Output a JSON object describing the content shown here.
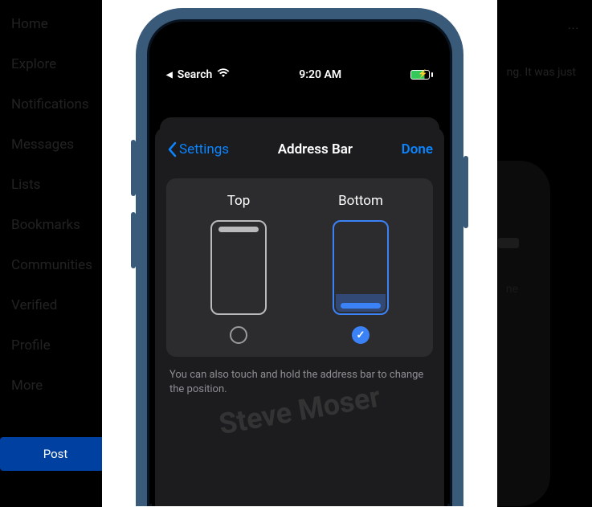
{
  "nav": {
    "items": [
      "Home",
      "Explore",
      "Notifications",
      "Messages",
      "Lists",
      "Bookmarks",
      "Communities",
      "Verified",
      "Profile",
      "More"
    ],
    "post": "Post"
  },
  "background": {
    "fragment": "ng. It was just",
    "ellipsis": "···",
    "phone_label": "ne"
  },
  "status": {
    "back_app": "Search",
    "time": "9:20 AM"
  },
  "sheet": {
    "back": "Settings",
    "title": "Address Bar",
    "done": "Done",
    "opt_top": "Top",
    "opt_bottom": "Bottom",
    "hint": "You can also touch and hold the address bar to change the position."
  },
  "watermark": "Steve Moser"
}
